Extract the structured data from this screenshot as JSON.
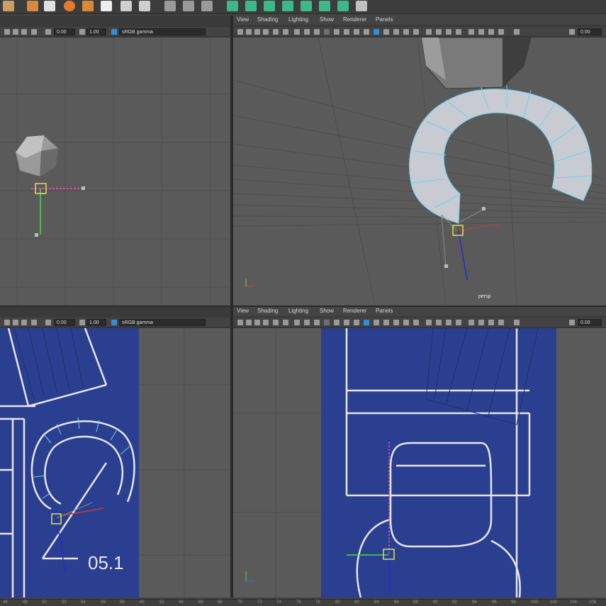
{
  "menus": {
    "view": "View",
    "shading": "Shading",
    "lighting": "Lighting",
    "show": "Show",
    "renderer": "Renderer",
    "panels": "Panels"
  },
  "toolbar": {
    "exposure": "0.00",
    "gamma": "1.00",
    "color_space": "sRGB gamma"
  },
  "panels": {
    "top_right": {
      "camera": "persp"
    }
  },
  "reference_image": {
    "label": "05.1"
  },
  "timeline": {
    "ticks": [
      "46",
      "48",
      "50",
      "52",
      "54",
      "56",
      "58",
      "60",
      "62",
      "64",
      "66",
      "68",
      "70",
      "72",
      "74",
      "76",
      "78",
      "80",
      "82",
      "84",
      "86",
      "88",
      "90",
      "92",
      "94",
      "96",
      "98",
      "100",
      "102",
      "104",
      "106"
    ]
  },
  "colors": {
    "viewport_bg": "#5a5a5a",
    "blueprint": "#2a3f8f",
    "mesh_face": "#c8ccd2",
    "mesh_edge": "#6fd0ee",
    "selection": "#e5e046",
    "accent": "#2f8fd8"
  }
}
